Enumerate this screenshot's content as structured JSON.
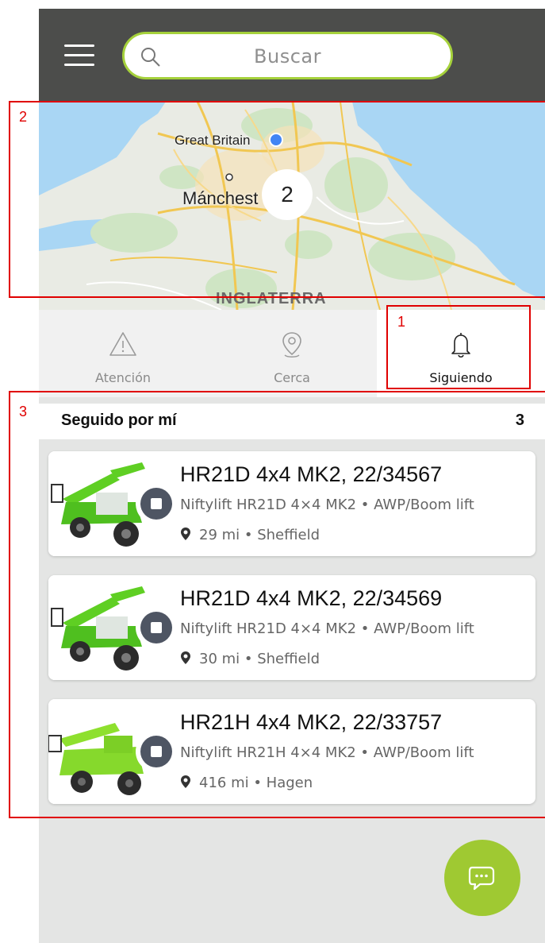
{
  "header": {
    "search_placeholder": "Buscar"
  },
  "map": {
    "labels": {
      "great_britain": "Great Britain",
      "manchester": "Mánchest",
      "inglaterra": "INGLATERRA"
    },
    "cluster_count": "2"
  },
  "tabs": [
    {
      "label": "Atención",
      "icon": "warning-icon",
      "active": false
    },
    {
      "label": "Cerca",
      "icon": "location-pin-icon",
      "active": false
    },
    {
      "label": "Siguiendo",
      "icon": "bell-icon",
      "active": true
    }
  ],
  "list": {
    "title": "Seguido por mí",
    "count": "3",
    "items": [
      {
        "name": "HR21D 4x4 MK2, 22/34567",
        "model": "Niftylift HR21D 4×4 MK2 • AWP/Boom lift",
        "location": "29 mi • Sheffield"
      },
      {
        "name": "HR21D 4x4 MK2, 22/34569",
        "model": "Niftylift HR21D 4×4 MK2 • AWP/Boom lift",
        "location": "30 mi • Sheffield"
      },
      {
        "name": "HR21H 4x4 MK2, 22/33757",
        "model": "Niftylift HR21H 4×4 MK2 • AWP/Boom lift",
        "location": "416 mi • Hagen"
      }
    ]
  },
  "annotations": [
    "1",
    "2",
    "3"
  ],
  "colors": {
    "header": "#4c4d4b",
    "accent": "#a5d13b",
    "fab": "#9fc932",
    "annotation": "#e00000"
  },
  "fab_icon": "chat-icon"
}
